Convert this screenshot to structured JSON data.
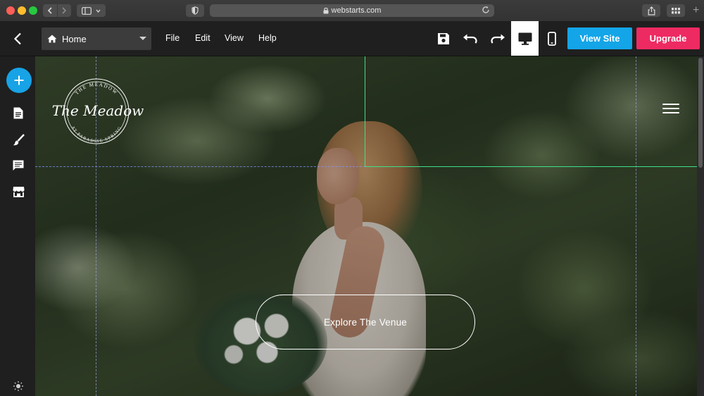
{
  "browser": {
    "url": "webstarts.com"
  },
  "toolbar": {
    "page_selector": "Home",
    "menus": [
      "File",
      "Edit",
      "View",
      "Help"
    ],
    "view_site_label": "View Site",
    "upgrade_label": "Upgrade"
  },
  "canvas": {
    "logo": {
      "top_arc": "THE MEADOW",
      "script": "The Meadow",
      "bottom_arc": "AT PARADISE SPRING"
    },
    "cta_label": "Explore The Venue"
  },
  "colors": {
    "accent_blue": "#13a5e8",
    "accent_pink": "#ee2a62",
    "selection_green": "#3de08a"
  }
}
